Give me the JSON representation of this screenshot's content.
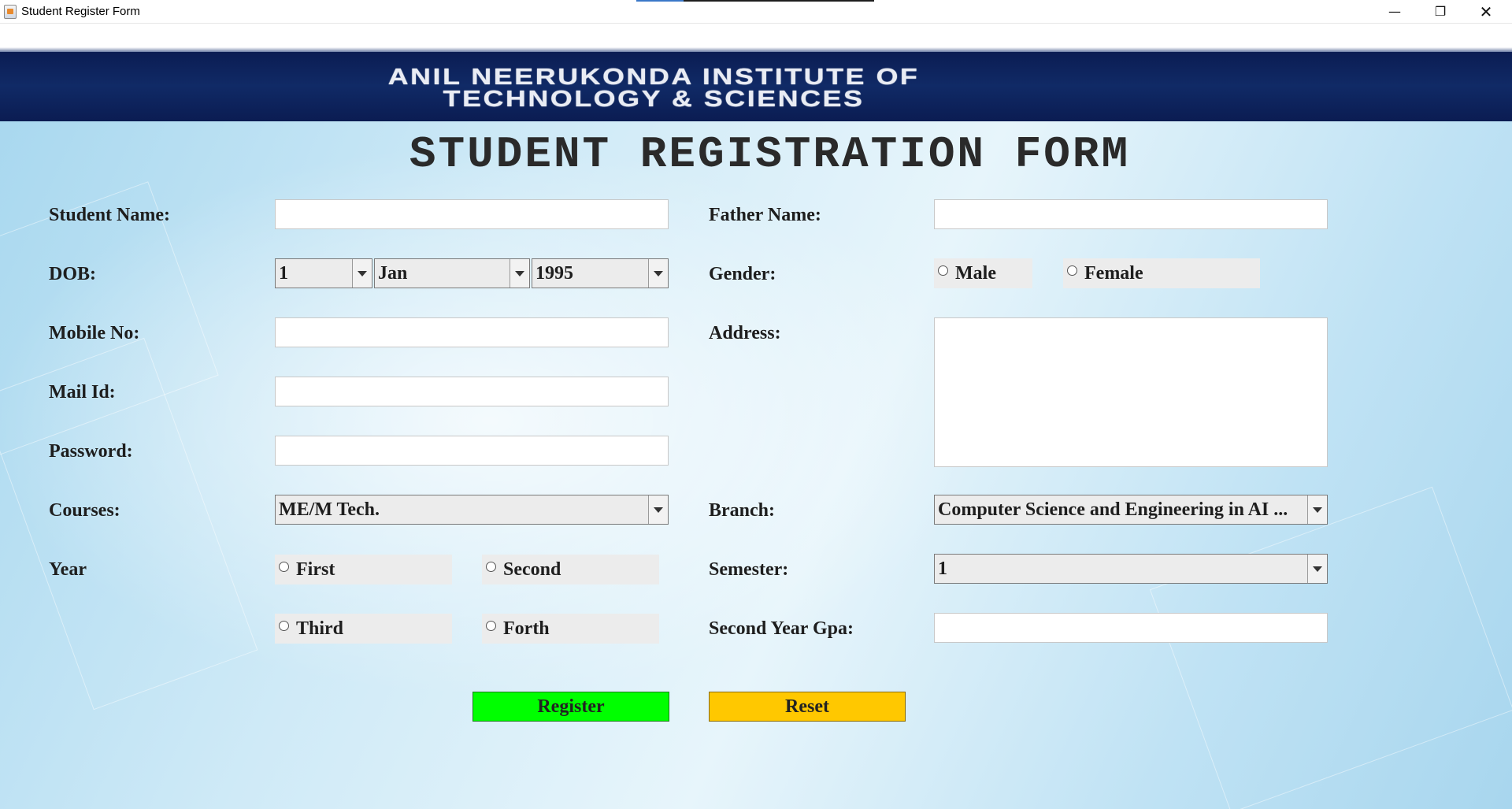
{
  "window": {
    "title": "Student Register Form",
    "minimize_icon": "minimize-icon",
    "maximize_icon": "restore-icon",
    "close_icon": "close-icon"
  },
  "header": {
    "institute_name": "ANIL NEERUKONDA INSTITUTE OF TECHNOLOGY & SCIENCES"
  },
  "form": {
    "title": "STUDENT REGISTRATION FORM",
    "student_name_label": "Student Name:",
    "student_name_value": "",
    "dob_label": "DOB:",
    "dob_day": "1",
    "dob_month": "Jan",
    "dob_year": "1995",
    "mobile_label": "Mobile No:",
    "mobile_value": "",
    "mail_label": "Mail Id:",
    "mail_value": "",
    "password_label": "Password:",
    "password_value": "",
    "courses_label": "Courses:",
    "course_selected": "ME/M Tech.",
    "year_label": "Year",
    "year_options": [
      "First",
      "Second",
      "Third",
      "Forth"
    ],
    "father_name_label": "Father Name:",
    "father_name_value": "",
    "gender_label": "Gender:",
    "gender_options": [
      "Male",
      "Female"
    ],
    "address_label": "Address:",
    "address_value": "",
    "branch_label": "Branch:",
    "branch_selected": "Computer Science and Engineering in AI ...",
    "semester_label": "Semester:",
    "semester_selected": "1",
    "second_year_gpa_label": "Second Year Gpa:",
    "second_year_gpa_value": "",
    "register_label": "Register",
    "reset_label": "Reset"
  },
  "colors": {
    "header_band": "#0b1c52",
    "register_button": "#00ff00",
    "reset_button": "#ffc800",
    "panel_background": "#cfeaf7"
  }
}
